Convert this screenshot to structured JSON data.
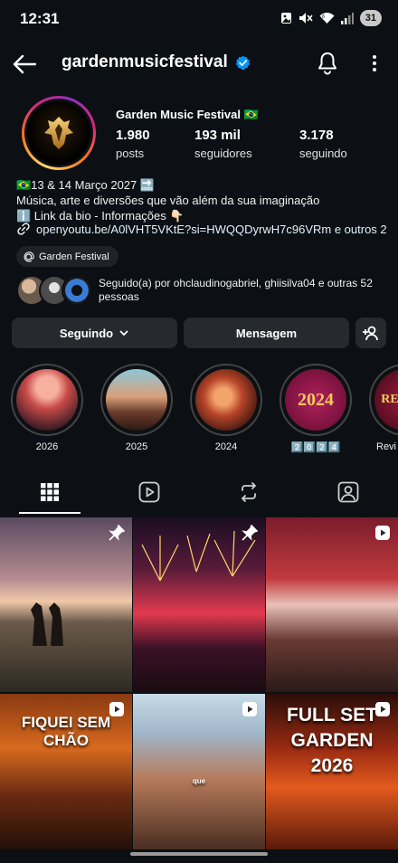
{
  "status": {
    "time": "12:31",
    "battery": "31",
    "icons": [
      "photo-icon",
      "mute-icon",
      "wifi-icon",
      "signal-icon",
      "battery-icon"
    ]
  },
  "header": {
    "username": "gardenmusicfestival",
    "verified": true
  },
  "profile": {
    "display_name": "Garden Music Festival 🇧🇷",
    "stats": [
      {
        "value": "1.980",
        "label": "posts"
      },
      {
        "value": "193 mil",
        "label": "seguidores"
      },
      {
        "value": "3.178",
        "label": "seguindo"
      }
    ],
    "bio": [
      "🇧🇷13 & 14 Março 2027 🔜",
      "Música, arte e diversões que vão além da sua imaginação",
      "ℹ️ Link da bio - Informações 👇🏻"
    ],
    "link": "openyoutu.be/A0lVHT5VKtE?si=HWQQDyrwH7c96VRm e outros 2",
    "threads_label": "Garden Festival",
    "followed_by": "Seguido(a) por ohclaudinogabriel, ghiisilva04 e outras 52 pessoas"
  },
  "actions": {
    "following": "Seguindo",
    "message": "Mensagem"
  },
  "highlights": [
    {
      "label": "2026"
    },
    {
      "label": "2025"
    },
    {
      "label": "2024"
    },
    {
      "label": "2️⃣0️⃣2️⃣4️⃣",
      "badge": "2024"
    },
    {
      "label": "Revi",
      "badge": "RE"
    }
  ],
  "tabs": [
    "grid-icon",
    "reels-icon",
    "reposts-icon",
    "tagged-icon"
  ],
  "posts": [
    {
      "type": "pinned",
      "caption": ""
    },
    {
      "type": "pinned",
      "caption": ""
    },
    {
      "type": "reel",
      "caption": ""
    },
    {
      "type": "reel",
      "caption": "FIQUEI SEM CHÃO"
    },
    {
      "type": "reel",
      "caption": "que"
    },
    {
      "type": "reel",
      "caption": "FULL SET GARDEN 2026"
    }
  ],
  "colors": {
    "background": "#0c1014",
    "button": "#262a2f",
    "verified": "#0095f6",
    "link": "#e0f1ff"
  }
}
